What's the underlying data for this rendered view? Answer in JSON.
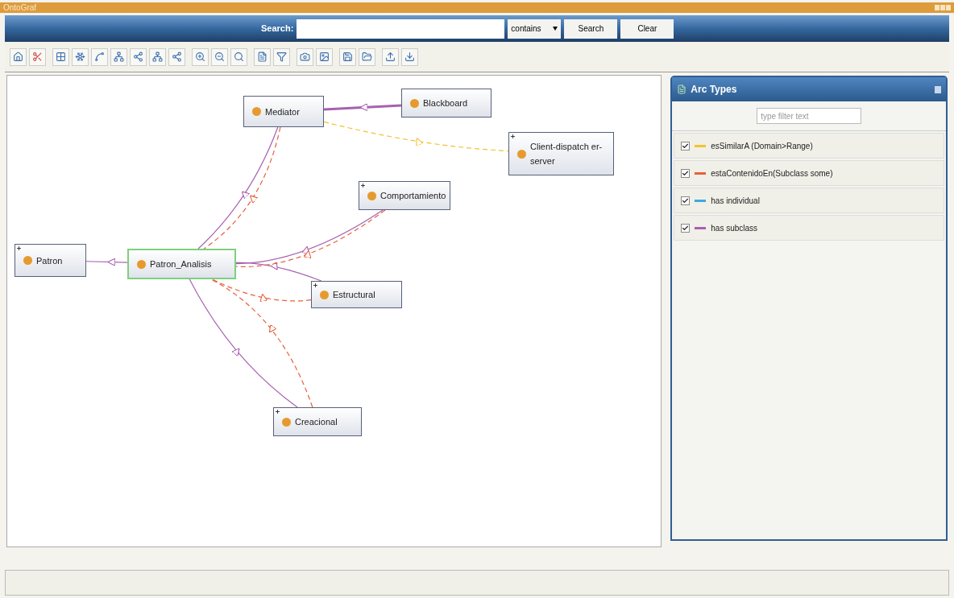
{
  "window": {
    "title": "OntoGraf"
  },
  "search": {
    "label": "Search:",
    "mode": "contains",
    "buttons": [
      "Search",
      "Clear"
    ]
  },
  "graph": {
    "nodes": [
      {
        "label": "Mediator",
        "expandable": false,
        "selected": false
      },
      {
        "label": "Blackboard",
        "expandable": false,
        "selected": false
      },
      {
        "label": "Client-dispatch er-server",
        "expandable": true,
        "selected": false
      },
      {
        "label": "Comportamiento",
        "expandable": true,
        "selected": false
      },
      {
        "label": "Patron",
        "expandable": true,
        "selected": false
      },
      {
        "label": "Patron_Analisis",
        "expandable": false,
        "selected": true
      },
      {
        "label": "Estructural",
        "expandable": true,
        "selected": false
      },
      {
        "label": "Creacional",
        "expandable": true,
        "selected": false
      }
    ]
  },
  "arc_types": {
    "title": "Arc Types",
    "filter_placeholder": "type filter text",
    "items": [
      {
        "label": "esSimilarA (Domain>Range)",
        "color": "#f2c230",
        "checked": true
      },
      {
        "label": "estaContenidoEn(Subclass some)",
        "color": "#e8603c",
        "checked": true
      },
      {
        "label": "has individual",
        "color": "#3fa8e0",
        "checked": true
      },
      {
        "label": "has subclass",
        "color": "#a860b0",
        "checked": true
      }
    ]
  }
}
